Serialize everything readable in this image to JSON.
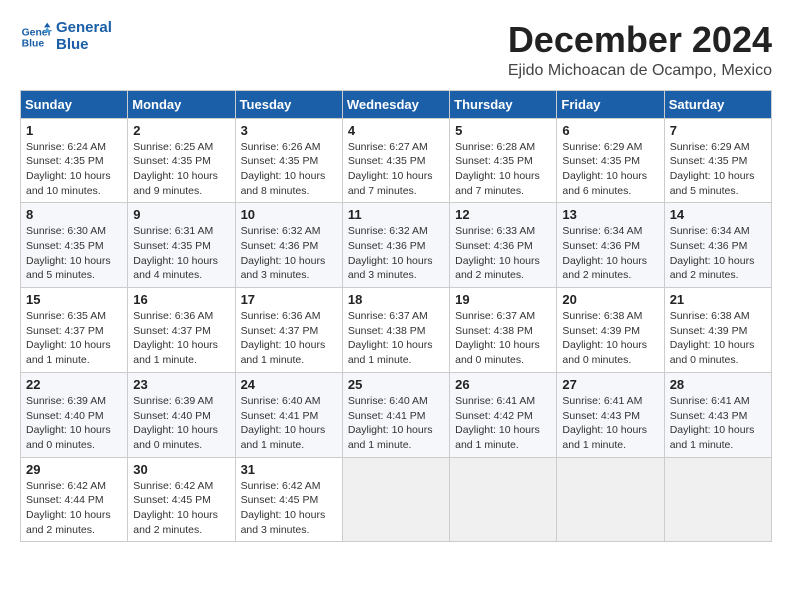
{
  "logo": {
    "line1": "General",
    "line2": "Blue"
  },
  "title": "December 2024",
  "location": "Ejido Michoacan de Ocampo, Mexico",
  "weekdays": [
    "Sunday",
    "Monday",
    "Tuesday",
    "Wednesday",
    "Thursday",
    "Friday",
    "Saturday"
  ],
  "weeks": [
    [
      {
        "day": "1",
        "info": "Sunrise: 6:24 AM\nSunset: 4:35 PM\nDaylight: 10 hours and 10 minutes."
      },
      {
        "day": "2",
        "info": "Sunrise: 6:25 AM\nSunset: 4:35 PM\nDaylight: 10 hours and 9 minutes."
      },
      {
        "day": "3",
        "info": "Sunrise: 6:26 AM\nSunset: 4:35 PM\nDaylight: 10 hours and 8 minutes."
      },
      {
        "day": "4",
        "info": "Sunrise: 6:27 AM\nSunset: 4:35 PM\nDaylight: 10 hours and 7 minutes."
      },
      {
        "day": "5",
        "info": "Sunrise: 6:28 AM\nSunset: 4:35 PM\nDaylight: 10 hours and 7 minutes."
      },
      {
        "day": "6",
        "info": "Sunrise: 6:29 AM\nSunset: 4:35 PM\nDaylight: 10 hours and 6 minutes."
      },
      {
        "day": "7",
        "info": "Sunrise: 6:29 AM\nSunset: 4:35 PM\nDaylight: 10 hours and 5 minutes."
      }
    ],
    [
      {
        "day": "8",
        "info": "Sunrise: 6:30 AM\nSunset: 4:35 PM\nDaylight: 10 hours and 5 minutes."
      },
      {
        "day": "9",
        "info": "Sunrise: 6:31 AM\nSunset: 4:35 PM\nDaylight: 10 hours and 4 minutes."
      },
      {
        "day": "10",
        "info": "Sunrise: 6:32 AM\nSunset: 4:36 PM\nDaylight: 10 hours and 3 minutes."
      },
      {
        "day": "11",
        "info": "Sunrise: 6:32 AM\nSunset: 4:36 PM\nDaylight: 10 hours and 3 minutes."
      },
      {
        "day": "12",
        "info": "Sunrise: 6:33 AM\nSunset: 4:36 PM\nDaylight: 10 hours and 2 minutes."
      },
      {
        "day": "13",
        "info": "Sunrise: 6:34 AM\nSunset: 4:36 PM\nDaylight: 10 hours and 2 minutes."
      },
      {
        "day": "14",
        "info": "Sunrise: 6:34 AM\nSunset: 4:36 PM\nDaylight: 10 hours and 2 minutes."
      }
    ],
    [
      {
        "day": "15",
        "info": "Sunrise: 6:35 AM\nSunset: 4:37 PM\nDaylight: 10 hours and 1 minute."
      },
      {
        "day": "16",
        "info": "Sunrise: 6:36 AM\nSunset: 4:37 PM\nDaylight: 10 hours and 1 minute."
      },
      {
        "day": "17",
        "info": "Sunrise: 6:36 AM\nSunset: 4:37 PM\nDaylight: 10 hours and 1 minute."
      },
      {
        "day": "18",
        "info": "Sunrise: 6:37 AM\nSunset: 4:38 PM\nDaylight: 10 hours and 1 minute."
      },
      {
        "day": "19",
        "info": "Sunrise: 6:37 AM\nSunset: 4:38 PM\nDaylight: 10 hours and 0 minutes."
      },
      {
        "day": "20",
        "info": "Sunrise: 6:38 AM\nSunset: 4:39 PM\nDaylight: 10 hours and 0 minutes."
      },
      {
        "day": "21",
        "info": "Sunrise: 6:38 AM\nSunset: 4:39 PM\nDaylight: 10 hours and 0 minutes."
      }
    ],
    [
      {
        "day": "22",
        "info": "Sunrise: 6:39 AM\nSunset: 4:40 PM\nDaylight: 10 hours and 0 minutes."
      },
      {
        "day": "23",
        "info": "Sunrise: 6:39 AM\nSunset: 4:40 PM\nDaylight: 10 hours and 0 minutes."
      },
      {
        "day": "24",
        "info": "Sunrise: 6:40 AM\nSunset: 4:41 PM\nDaylight: 10 hours and 1 minute."
      },
      {
        "day": "25",
        "info": "Sunrise: 6:40 AM\nSunset: 4:41 PM\nDaylight: 10 hours and 1 minute."
      },
      {
        "day": "26",
        "info": "Sunrise: 6:41 AM\nSunset: 4:42 PM\nDaylight: 10 hours and 1 minute."
      },
      {
        "day": "27",
        "info": "Sunrise: 6:41 AM\nSunset: 4:43 PM\nDaylight: 10 hours and 1 minute."
      },
      {
        "day": "28",
        "info": "Sunrise: 6:41 AM\nSunset: 4:43 PM\nDaylight: 10 hours and 1 minute."
      }
    ],
    [
      {
        "day": "29",
        "info": "Sunrise: 6:42 AM\nSunset: 4:44 PM\nDaylight: 10 hours and 2 minutes."
      },
      {
        "day": "30",
        "info": "Sunrise: 6:42 AM\nSunset: 4:45 PM\nDaylight: 10 hours and 2 minutes."
      },
      {
        "day": "31",
        "info": "Sunrise: 6:42 AM\nSunset: 4:45 PM\nDaylight: 10 hours and 3 minutes."
      },
      null,
      null,
      null,
      null
    ]
  ]
}
